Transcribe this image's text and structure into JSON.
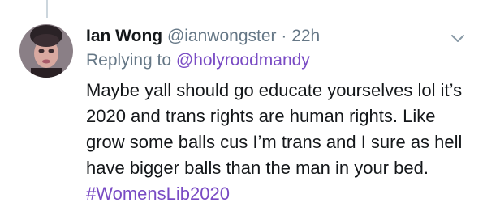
{
  "tweet": {
    "display_name": "Ian Wong",
    "handle": "@ianwongster",
    "separator": "·",
    "timestamp": "22h",
    "reply_prefix": "Replying to",
    "reply_to": "@holyroodmandy",
    "text": "Maybe yall should go educate yourselves lol it’s 2020 and trans rights are human rights. Like grow some balls cus I’m trans and I sure as hell have bigger balls than the man in your bed.",
    "hashtag": "#WomensLib2020"
  },
  "icons": {
    "avatar": "user-avatar",
    "menu": "chevron-down-icon"
  },
  "colors": {
    "text": "#14171a",
    "secondary": "#657786",
    "link": "#794bc4",
    "thread_line": "#ccd6dd"
  }
}
